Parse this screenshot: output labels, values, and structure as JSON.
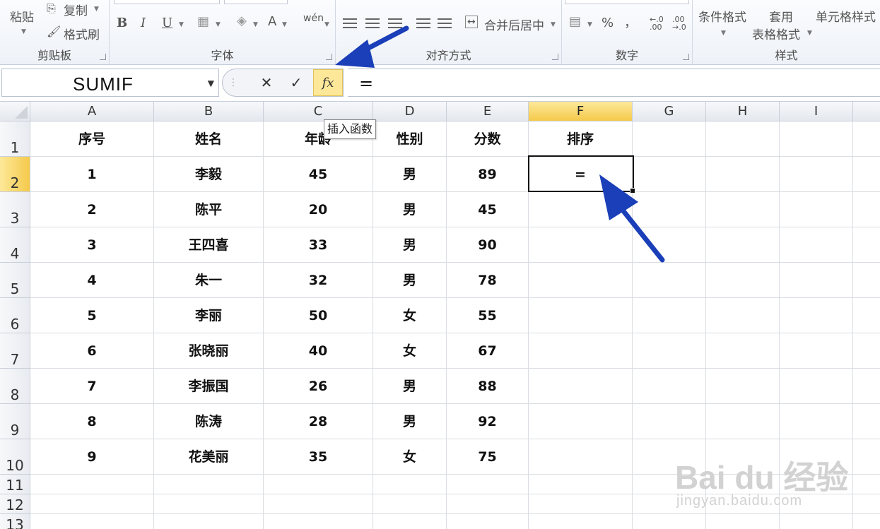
{
  "ribbon": {
    "clipboard": {
      "paste": "粘贴",
      "copy": "复制",
      "format_painter": "格式刷",
      "label": "剪贴板"
    },
    "font": {
      "bold": "B",
      "italic": "I",
      "underline": "U",
      "font_color": "A",
      "phonetic": "wén",
      "label": "字体"
    },
    "alignment": {
      "merge_center": "合并后居中",
      "label": "对齐方式"
    },
    "number": {
      "percent": "%",
      "comma": "，",
      "inc_decimal": "←.0 .00",
      "dec_decimal": ".00 →.0",
      "label": "数字"
    },
    "styles": {
      "conditional": "条件格式",
      "table_line1": "套用",
      "table_line2": "表格格式",
      "cell_styles": "单元格样式",
      "label": "样式"
    }
  },
  "formula_bar": {
    "name_box": "SUMIF",
    "cancel": "✕",
    "enter": "✓",
    "fx": "fx",
    "formula": "="
  },
  "tooltip": "插入函数",
  "columns": [
    "A",
    "B",
    "C",
    "D",
    "E",
    "F",
    "G",
    "H",
    "I"
  ],
  "rows": [
    "1",
    "2",
    "3",
    "4",
    "5",
    "6",
    "7",
    "8",
    "9",
    "10",
    "11",
    "12",
    "13"
  ],
  "header": {
    "a": "序号",
    "b": "姓名",
    "c": "年龄",
    "d": "性别",
    "e": "分数",
    "f": "排序"
  },
  "data_rows": [
    {
      "a": "1",
      "b": "李毅",
      "c": "45",
      "d": "男",
      "e": "89",
      "f": "="
    },
    {
      "a": "2",
      "b": "陈平",
      "c": "20",
      "d": "男",
      "e": "45",
      "f": ""
    },
    {
      "a": "3",
      "b": "王四喜",
      "c": "33",
      "d": "男",
      "e": "90",
      "f": ""
    },
    {
      "a": "4",
      "b": "朱一",
      "c": "32",
      "d": "男",
      "e": "78",
      "f": ""
    },
    {
      "a": "5",
      "b": "李丽",
      "c": "50",
      "d": "女",
      "e": "55",
      "f": ""
    },
    {
      "a": "6",
      "b": "张晓丽",
      "c": "40",
      "d": "女",
      "e": "67",
      "f": ""
    },
    {
      "a": "7",
      "b": "李振国",
      "c": "26",
      "d": "男",
      "e": "88",
      "f": ""
    },
    {
      "a": "8",
      "b": "陈涛",
      "c": "28",
      "d": "男",
      "e": "92",
      "f": ""
    },
    {
      "a": "9",
      "b": "花美丽",
      "c": "35",
      "d": "女",
      "e": "75",
      "f": ""
    }
  ],
  "watermark": {
    "main": "Bai du 经验",
    "sub": "jingyan.baidu.com"
  },
  "colors": {
    "selection": "#f5c94b",
    "arrow": "#1a3fb8",
    "grid_line": "#dadde2"
  }
}
